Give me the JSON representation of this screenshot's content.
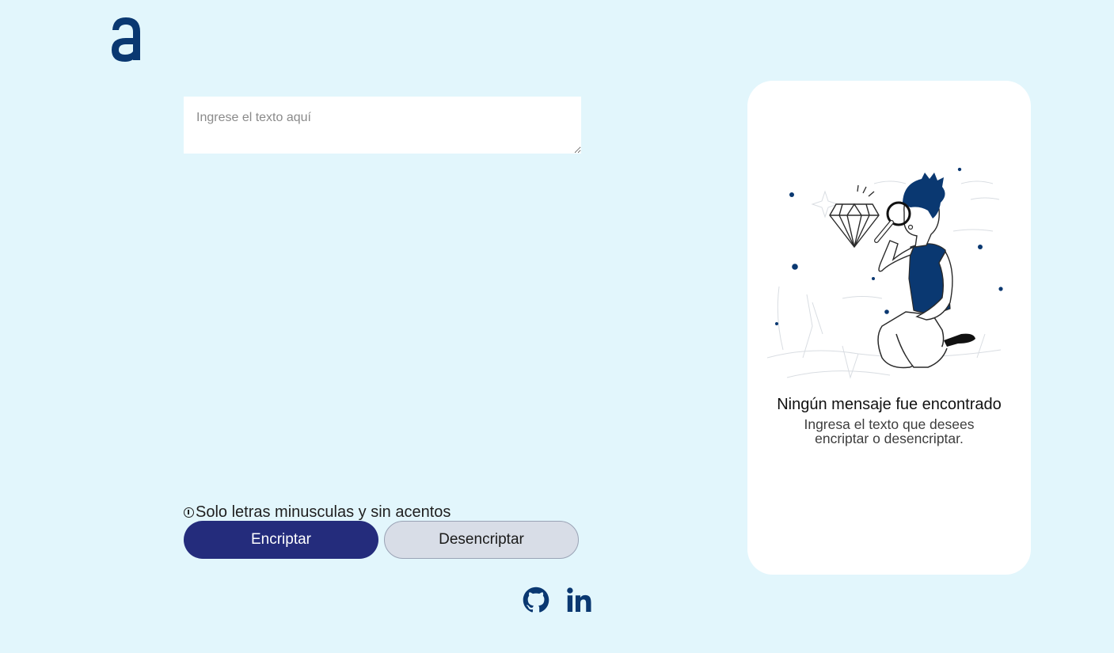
{
  "logo": {
    "icon": "alura-a-logo-icon"
  },
  "input": {
    "placeholder": "Ingrese el texto aquí",
    "value": ""
  },
  "warning": {
    "icon": "info-icon",
    "text": "Solo letras minusculas y sin acentos"
  },
  "buttons": {
    "encrypt_label": "Encriptar",
    "decrypt_label": "Desencriptar"
  },
  "result_panel": {
    "illustration": "boy-with-magnifier-illustration",
    "title": "Ningún mensaje fue encontrado",
    "subtitle": "Ingresa el texto que desees encriptar o desencriptar."
  },
  "footer": {
    "github_icon": "github-icon",
    "linkedin_icon": "linkedin-icon"
  },
  "colors": {
    "background": "#e2f6fc",
    "primary": "#242c7c",
    "secondary": "#d8dde7",
    "brand": "#0a3871"
  }
}
